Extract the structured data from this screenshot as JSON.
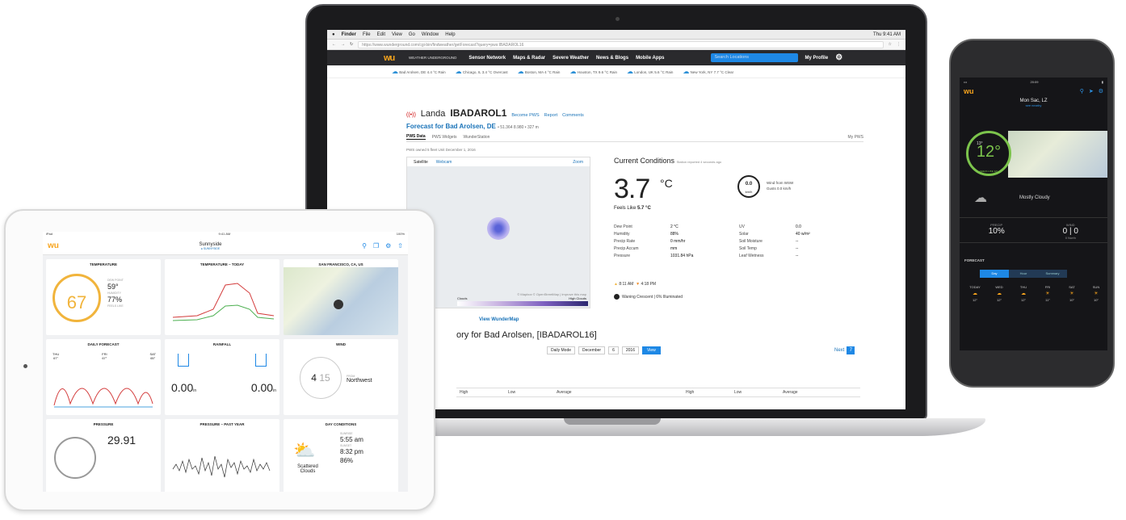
{
  "laptop": {
    "menubar": {
      "app": "Finder",
      "menus": [
        "File",
        "Edit",
        "View",
        "Go",
        "Window",
        "Help"
      ],
      "clock": "Thu 9:41 AM"
    },
    "url": "https://www.wunderground.com/cgi-bin/findweather/getForecast?query=pws:IBADAROL16",
    "nav": {
      "logo_text": "WEATHER UNDERGROUND",
      "items": [
        "Sensor Network",
        "Maps & Radar",
        "Severe Weather",
        "News & Blogs",
        "Mobile Apps"
      ],
      "search_placeholder": "Search Locations",
      "profile": "My Profile"
    },
    "cities": [
      {
        "name": "Bad Arolsen, DE",
        "cond": "4.4 °C Rain"
      },
      {
        "name": "Chicago, IL",
        "cond": "3.4 °C Overcast"
      },
      {
        "name": "Boston, MA",
        "cond": "4 °C Rain"
      },
      {
        "name": "Houston, TX",
        "cond": "9.6 °C Rain"
      },
      {
        "name": "London, UK",
        "cond": "5.6 °C Rain"
      },
      {
        "name": "New York, NY",
        "cond": "7.7 °C Clear"
      }
    ],
    "station": {
      "name_prefix": "Landa",
      "id": "IBADAROL1",
      "links": [
        "Become PWS",
        "Report",
        "Comments"
      ],
      "forecast_label": "Forecast for Bad Arolsen, DE",
      "forecast_coords": "• 51.364 8.980 • 327 m"
    },
    "tabs": [
      "PWS Data",
      "PWS Widgets",
      "WunderStation"
    ],
    "tabs_right": "My PWS",
    "note": "PWS owned 5 fleet Unit December 1, 2016",
    "map": {
      "tabs": [
        "Satellite",
        "Webcam"
      ],
      "right_link": "Zoom",
      "attribution": "© Mapbox © OpenStreetMap | Improve this map",
      "scale_left": "Clouds",
      "scale_right": "High Clouds",
      "view_link": "View WunderMap"
    },
    "history": {
      "title": "ory for Bad Arolsen, [IBADAROL16]",
      "mode": "Daily Mode",
      "month": "December",
      "day": "6",
      "year": "2016",
      "view_btn": "View",
      "next": "Next",
      "next_num": "7",
      "columns": [
        "High",
        "Low",
        "Average",
        "High",
        "Low",
        "Average"
      ]
    },
    "current": {
      "title": "Current Conditions",
      "subtitle": "Station reported 4 seconds ago",
      "temp": "3.7",
      "unit": "°C",
      "feels_label": "Feels Like",
      "feels": "5.7 °C",
      "wind_speed": "0.0",
      "wind_unit": "km/h",
      "wind_from": "Wind from WSW",
      "gusts": "Gusts 0.0 km/h",
      "rows": [
        [
          "Dew Point",
          "2 °C",
          "UV",
          "0.0"
        ],
        [
          "Humidity",
          "88%",
          "Solar",
          "40 w/m²"
        ],
        [
          "Precip Rate",
          "0 mm/hr",
          "Soil Moisture",
          "--"
        ],
        [
          "Precip Accum",
          "mm",
          "Soil Temp",
          "--"
        ],
        [
          "Pressure",
          "1031.84 hPa",
          "Leaf Wetness",
          "--"
        ]
      ],
      "sunrise": "8:11 AM",
      "sunset": "4:18 PM",
      "moon": "Waning Crescent | 6% Illuminated"
    }
  },
  "phone": {
    "time": "20:09",
    "location": "Mon Sac, LZ",
    "location_sub": "see nearby",
    "temp": "12°",
    "hi": "13°",
    "lo": "7°",
    "feels": "FEELS LIKE 12°",
    "condition": "Mostly Cloudy",
    "precip_label": "PRECIP",
    "precip": "10%",
    "wind_label": "WIND",
    "wind": "0 | 0",
    "wind_dir": "0 North",
    "forecast_label": "FORECAST",
    "forecast_tabs": [
      "Day",
      "Hour",
      "Summary"
    ],
    "days": [
      {
        "d": "TODAY",
        "t": "12°"
      },
      {
        "d": "WED",
        "t": "12°"
      },
      {
        "d": "THU",
        "t": "12°"
      },
      {
        "d": "FRI",
        "t": "11°"
      },
      {
        "d": "SAT",
        "t": "10°"
      },
      {
        "d": "SUN",
        "t": "10°"
      }
    ]
  },
  "tablet": {
    "status_left": "iPad",
    "status_time": "9:41 AM",
    "status_right": "100%",
    "location": "Sunnyside",
    "location_sub": "● SUNNYSIDE",
    "cards": {
      "temperature": {
        "title": "TEMPERATURE",
        "temp": "67",
        "dewpoint_label": "DEW POINT",
        "dewpoint": "59°",
        "humidity_label": "HUMIDITY",
        "humidity": "77%",
        "feels": "FEELS LIKE"
      },
      "temp_today": {
        "title": "TEMPERATURE – TODAY"
      },
      "map": {
        "title": "SAN FRANCISCO, CA, US"
      },
      "daily": {
        "title": "DAILY FORECAST",
        "days": [
          "THU",
          "FRI",
          "SAT"
        ],
        "temps": [
          "67°",
          "67°",
          "65°"
        ]
      },
      "rainfall": {
        "title": "RAINFALL",
        "today": "0.00",
        "today_unit": "in",
        "past": "0.00",
        "past_unit": "in"
      },
      "wind": {
        "title": "WIND",
        "speed": "4",
        "gust": "15",
        "dir_label": "FROM",
        "dir": "Northwest"
      },
      "pressure": {
        "title": "PRESSURE",
        "value": "29.91"
      },
      "pressure_year": {
        "title": "PRESSURE – PAST YEAR"
      },
      "day": {
        "title": "DAY CONDITIONS",
        "cond1": "Scattered",
        "cond2": "Clouds",
        "sunrise_label": "SUNRISE",
        "sunrise": "5:55 am",
        "sunset_label": "SUNSET",
        "sunset": "8:32 pm",
        "humidity": "86%"
      }
    }
  }
}
